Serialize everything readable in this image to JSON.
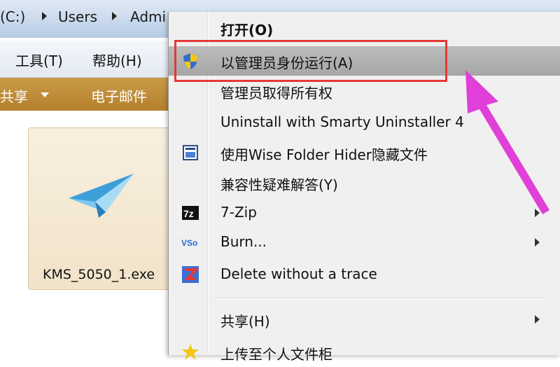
{
  "address_bar": {
    "drive": "(C:)",
    "crumbs": [
      "Users",
      "Admi"
    ]
  },
  "menubar": {
    "items": [
      "工具(T)",
      "帮助(H)"
    ]
  },
  "toolbar": {
    "items": [
      "共享",
      "电子邮件"
    ]
  },
  "file": {
    "name": "KMS_5050_1.exe",
    "icon": "paper-plane-icon"
  },
  "context_menu": {
    "items": [
      {
        "label": "打开(O)",
        "icon": null,
        "submenu": false
      },
      {
        "label": "以管理员身份运行(A)",
        "icon": "uac-shield-icon",
        "submenu": false,
        "highlighted": true
      },
      {
        "label": "管理员取得所有权",
        "icon": null,
        "submenu": false
      },
      {
        "label": "Uninstall with Smarty Uninstaller 4",
        "icon": null,
        "submenu": false
      },
      {
        "label": "使用Wise Folder Hider隐藏文件",
        "icon": "wise-folder-hider-icon",
        "submenu": false
      },
      {
        "label": "兼容性疑难解答(Y)",
        "icon": null,
        "submenu": false
      },
      {
        "label": "7-Zip",
        "icon": "7zip-icon",
        "submenu": true
      },
      {
        "label": "Burn...",
        "icon": "burn-icon",
        "submenu": true
      },
      {
        "label": "Delete without a trace",
        "icon": "delete-trace-icon",
        "submenu": false
      },
      {
        "label": "共享(H)",
        "icon": null,
        "submenu": true
      },
      {
        "label": "上传至个人文件柜",
        "icon": "star-icon",
        "submenu": false
      }
    ]
  },
  "colors": {
    "highlight_box": "#e53935",
    "arrow": "#e040d8",
    "toolbar": "#b6802d"
  }
}
